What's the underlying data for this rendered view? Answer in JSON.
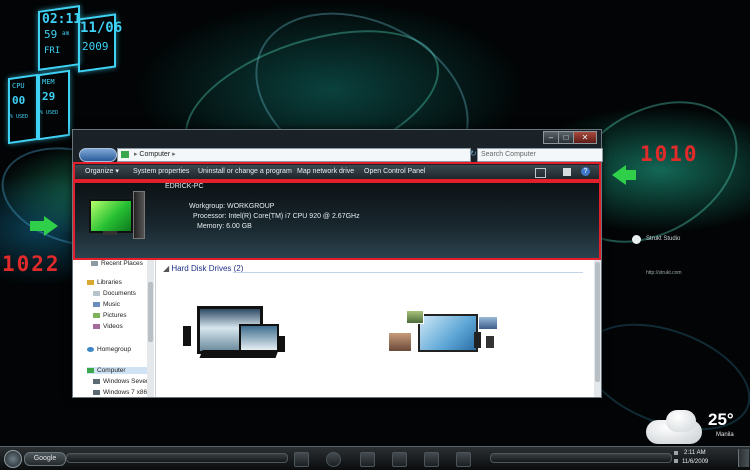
{
  "gadgets": {
    "clock_time": "02:11",
    "clock_seconds": "59",
    "clock_ampm": "am",
    "clock_date": "11/06",
    "clock_day": "FRI",
    "clock_year": "2009",
    "cpu_label": "CPU",
    "cpu_value": "00",
    "cpu_unit": "% USED",
    "mem_label": "MEM",
    "mem_value": "29",
    "mem_unit": "% USED"
  },
  "callouts": {
    "width": "1010",
    "height": "1022"
  },
  "desktop_side": {
    "studio_name": "Strukt Studio",
    "studio_url": "http://strukt.com"
  },
  "window": {
    "breadcrumb": "Computer",
    "search_placeholder": "Search Computer",
    "toolbar": {
      "organize": "Organize",
      "system_properties": "System properties",
      "uninstall": "Uninstall or change a program",
      "map_drive": "Map network drive",
      "open_control_panel": "Open Control Panel"
    },
    "details": {
      "computer_name": "EDRICK-PC",
      "workgroup": "Workgroup:  WORKGROUP",
      "processor": "Processor:  Intel(R) Core(TM) i7 CPU        920  @ 2.67GHz",
      "memory": "Memory:  6.00 GB"
    },
    "nav": {
      "recent": "Recent Places",
      "libraries": "Libraries",
      "documents": "Documents",
      "music": "Music",
      "pictures": "Pictures",
      "videos": "Videos",
      "homegroup": "Homegroup",
      "computer": "Computer",
      "drive1": "Windows Seven",
      "drive2": "Windows 7 x86"
    },
    "content": {
      "group_header": "Hard Disk Drives (2)"
    }
  },
  "taskbar": {
    "search_label": "Google",
    "clock_time": "2:11 AM",
    "clock_date": "11/6/2009"
  },
  "weather": {
    "temperature": "25°",
    "city": "Manila"
  }
}
